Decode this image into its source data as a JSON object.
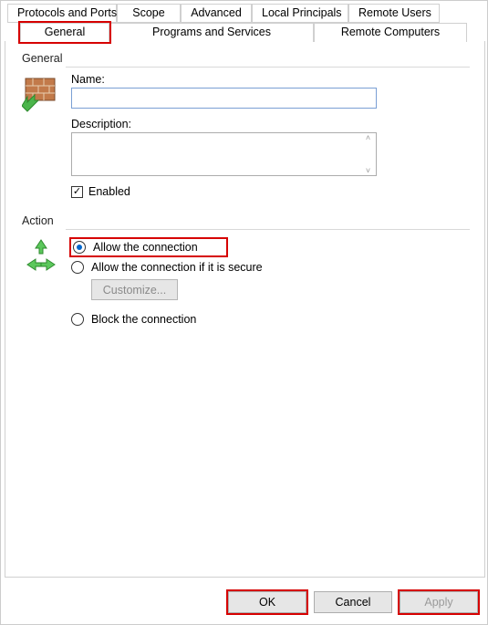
{
  "tabs": {
    "back": [
      "Protocols and Ports",
      "Scope",
      "Advanced",
      "Local Principals",
      "Remote Users"
    ],
    "front": [
      "General",
      "Programs and Services",
      "Remote Computers"
    ],
    "active": "General"
  },
  "general": {
    "group_label": "General",
    "name_label": "Name:",
    "name_value": "",
    "description_label": "Description:",
    "description_value": "",
    "enabled_label": "Enabled",
    "enabled_checked": true
  },
  "action": {
    "group_label": "Action",
    "radios": {
      "allow": "Allow the connection",
      "allow_secure": "Allow the connection if it is secure",
      "block": "Block the connection"
    },
    "selected": "allow",
    "customize_label": "Customize..."
  },
  "buttons": {
    "ok": "OK",
    "cancel": "Cancel",
    "apply": "Apply"
  }
}
